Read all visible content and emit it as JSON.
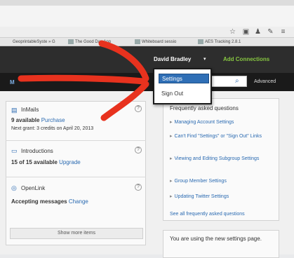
{
  "browser": {
    "bookmarks": [
      {
        "label": "GeoprintableSyste » G"
      },
      {
        "label": "The Good Day App"
      },
      {
        "label": "Whiteboard sessio"
      },
      {
        "label": "AES Tracking 2.8.1"
      }
    ]
  },
  "header": {
    "user_name": "David Bradley",
    "caret": "▾",
    "add_connections": "Add Connections"
  },
  "nav": {
    "more_label": "M",
    "search_placeholder": "",
    "advanced_label": "Advanced"
  },
  "dropdown": {
    "items": [
      {
        "label": "Settings",
        "selected": true
      },
      {
        "label": "Sign Out",
        "selected": false
      }
    ]
  },
  "left": {
    "inmails": {
      "title": "InMails",
      "count": "9 available",
      "action": "Purchase",
      "next_grant": "Next grant: 3 credits on April 20, 2013"
    },
    "introductions": {
      "title": "Introductions",
      "count": "15 of 15 available",
      "action": "Upgrade"
    },
    "openlink": {
      "title": "OpenLink",
      "status": "Accepting messages",
      "action": "Change"
    },
    "show_more": "Show more items"
  },
  "right": {
    "faq_heading": "Frequently asked questions",
    "faq_items": [
      {
        "label": "Managing Account Settings"
      },
      {
        "label": "Can't Find \"Settings\" or \"Sign Out\" Links"
      },
      {
        "label": "Viewing and Editing Subgroup Settings"
      },
      {
        "label": "Group Member Settings"
      },
      {
        "label": "Updating Twitter Settings"
      }
    ],
    "faq_all": "See all frequently asked questions",
    "new_settings": "You are using the new settings page."
  },
  "colors": {
    "accent": "#2a6ab1",
    "header_bg": "#2d2d2d",
    "add_connections": "#86c541",
    "annotation": "#e8321e"
  },
  "icons": [
    "shield-icon",
    "introductions-icon",
    "openlink-icon",
    "search-icon",
    "help-icon",
    "star-icon",
    "wrench-icon",
    "menu-icon"
  ]
}
